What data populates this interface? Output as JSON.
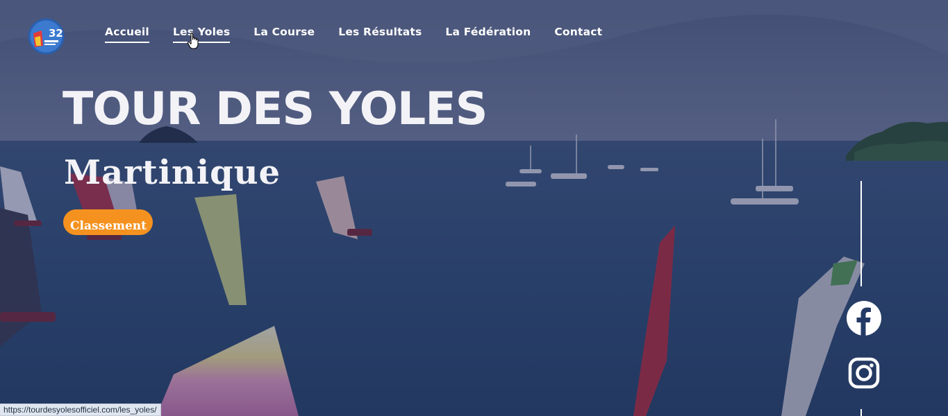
{
  "header": {
    "logo_name": "tour-des-yoles-logo",
    "nav": [
      {
        "label": "Accueil",
        "active": true
      },
      {
        "label": "Les Yoles",
        "hovered": true
      },
      {
        "label": "La Course"
      },
      {
        "label": "Les Résultats"
      },
      {
        "label": "La Fédération"
      },
      {
        "label": "Contact"
      }
    ]
  },
  "hero": {
    "title": "TOUR DES YOLES",
    "subtitle": "Martinique",
    "cta_label": "Classement",
    "background": "aerial-sea-sailboats-photo"
  },
  "social": {
    "facebook": "facebook-icon",
    "instagram": "instagram-icon"
  },
  "status_bar": {
    "url": "https://tourdesyolesofficiel.com/les_yoles/"
  },
  "colors": {
    "accent": "#f5921f",
    "overlay": "#1e2350",
    "text": "#ffffff",
    "sea": "#2e4b6e"
  }
}
